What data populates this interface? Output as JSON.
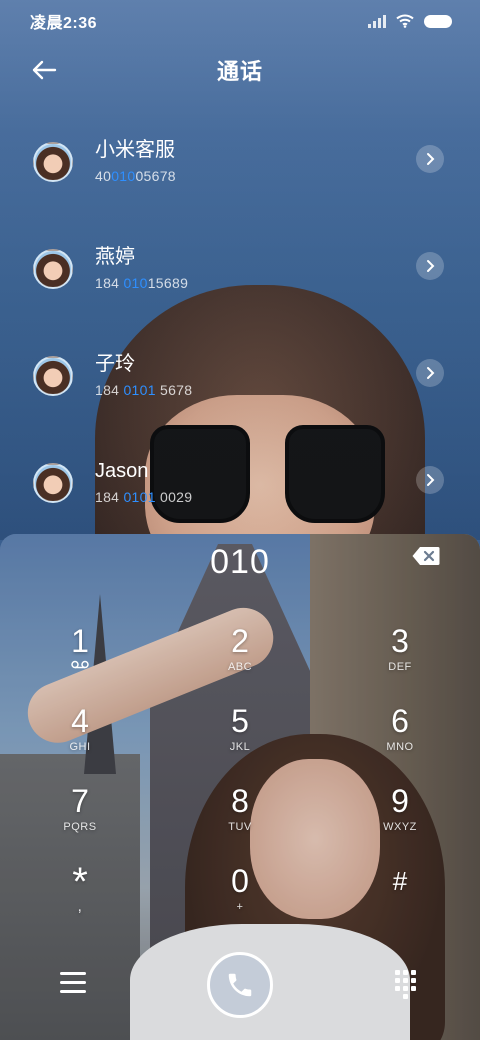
{
  "status_bar": {
    "time": "凌晨2:36",
    "icons": [
      "signal-icon",
      "wifi-icon",
      "battery-icon"
    ]
  },
  "header": {
    "title": "通话",
    "back_icon": "back-arrow-icon"
  },
  "contacts": [
    {
      "name": "小米客服",
      "number_prefix": "40",
      "number_match": "010",
      "number_suffix": "05678"
    },
    {
      "name": "燕婷",
      "number_prefix": "184 ",
      "number_match": "010",
      "number_suffix": "15689"
    },
    {
      "name": "子玲",
      "number_prefix": "184 ",
      "number_match": "0101",
      "number_suffix": " 5678"
    },
    {
      "name": "Jason",
      "number_prefix": "184 ",
      "number_match": "0101",
      "number_suffix": " 0029"
    }
  ],
  "dialer": {
    "entered_digits": "010",
    "keys": [
      {
        "digit": "1",
        "letters": "voicemail-icon"
      },
      {
        "digit": "2",
        "letters": "ABC"
      },
      {
        "digit": "3",
        "letters": "DEF"
      },
      {
        "digit": "4",
        "letters": "GHI"
      },
      {
        "digit": "5",
        "letters": "JKL"
      },
      {
        "digit": "6",
        "letters": "MNO"
      },
      {
        "digit": "7",
        "letters": "PQRS"
      },
      {
        "digit": "8",
        "letters": "TUV"
      },
      {
        "digit": "9",
        "letters": "WXYZ"
      },
      {
        "digit": "*",
        "letters": ","
      },
      {
        "digit": "0",
        "letters": "+"
      },
      {
        "digit": "#",
        "letters": ""
      }
    ]
  },
  "colors": {
    "match_highlight": "#2e8fff"
  }
}
